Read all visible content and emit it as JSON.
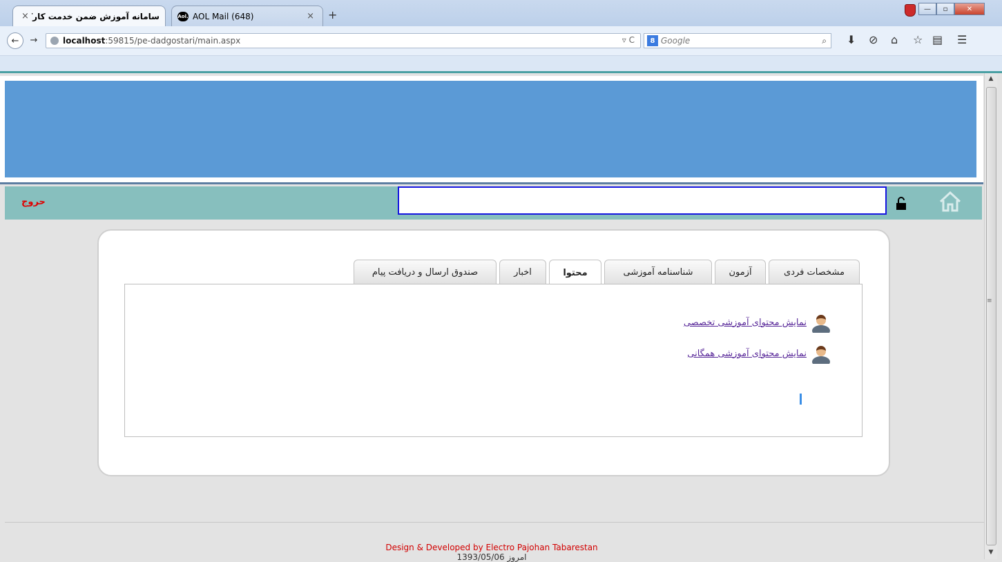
{
  "browser": {
    "tabs": [
      {
        "title": "سامانه آموزش ضمن خدمت کارکنان",
        "active": true
      },
      {
        "title": "AOL Mail (648)",
        "active": false,
        "icon_text": "Aol."
      }
    ],
    "new_tab_label": "+",
    "close_label": "×",
    "url_host": "localhost",
    "url_rest": ":59815/pe-dadgostari/main.aspx",
    "search_placeholder": "Google",
    "search_engine_icon": "8"
  },
  "header": {
    "logout_label": "حروج",
    "user_box_value": ""
  },
  "content_tabs": [
    {
      "label": "مشخصات فردی",
      "selected": false
    },
    {
      "label": "آزمون",
      "selected": false
    },
    {
      "label": "شناسنامه آموزشی",
      "selected": false
    },
    {
      "label": "محتوا",
      "selected": true
    },
    {
      "label": "اخبار",
      "selected": false
    },
    {
      "label": "صندوق  ارسال و دریافت پیام",
      "selected": false
    }
  ],
  "links": [
    {
      "label": "نمایش محتوای آموزشی تخصصی"
    },
    {
      "label": "نمایش محتوای آموزشی همگانی"
    }
  ],
  "footer": {
    "credit": "Design & Developed by Electro Pajohan Tabarestan",
    "date_text": "امروز 1393/05/06"
  },
  "colors": {
    "banner": "#5b9ad6",
    "toolbar": "#87bfbe",
    "logout": "#e00000",
    "user_box_border": "#1515e0",
    "footer_credit": "#d20000"
  }
}
